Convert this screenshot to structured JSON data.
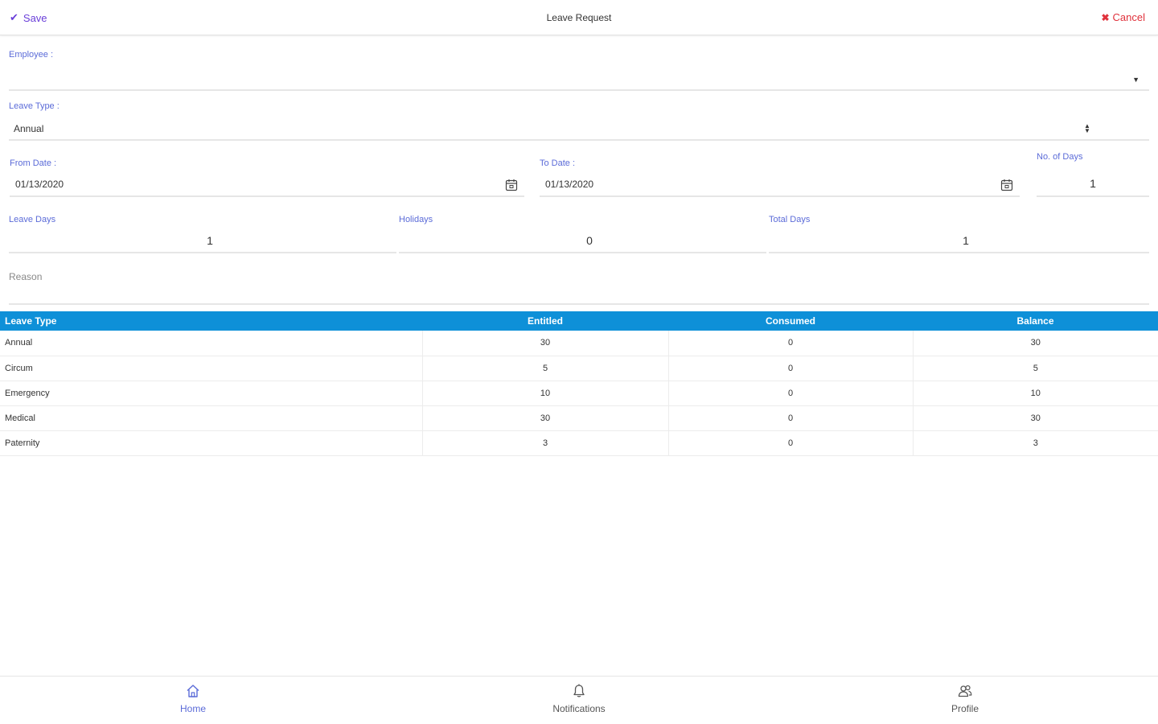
{
  "header": {
    "save_label": "Save",
    "title": "Leave Request",
    "cancel_label": "Cancel"
  },
  "form": {
    "employee": {
      "label": "Employee :",
      "value": ""
    },
    "leave_type": {
      "label": "Leave Type :",
      "value": "Annual"
    },
    "from_date": {
      "label": "From Date :",
      "value": "01/13/2020"
    },
    "to_date": {
      "label": "To Date :",
      "value": "01/13/2020"
    },
    "no_of_days": {
      "label": "No. of Days",
      "value": "1"
    },
    "leave_days": {
      "label": "Leave Days",
      "value": "1"
    },
    "holidays": {
      "label": "Holidays",
      "value": "0"
    },
    "total_days": {
      "label": "Total Days",
      "value": "1"
    },
    "reason": {
      "placeholder": "Reason"
    }
  },
  "table": {
    "headers": [
      "Leave Type",
      "Entitled",
      "Consumed",
      "Balance"
    ],
    "rows": [
      [
        "Annual",
        "30",
        "0",
        "30"
      ],
      [
        "Circum",
        "5",
        "0",
        "5"
      ],
      [
        "Emergency",
        "10",
        "0",
        "10"
      ],
      [
        "Medical",
        "30",
        "0",
        "30"
      ],
      [
        "Paternity",
        "3",
        "0",
        "3"
      ]
    ]
  },
  "nav": {
    "items": [
      {
        "label": "Home",
        "icon": "home-icon",
        "active": true
      },
      {
        "label": "Notifications",
        "icon": "bell-icon",
        "active": false
      },
      {
        "label": "Profile",
        "icon": "users-icon",
        "active": false
      }
    ]
  },
  "colors": {
    "accent": "#5b6bd8",
    "save": "#6a3fd9",
    "cancel": "#e0323c",
    "table_header": "#0e90d8"
  }
}
